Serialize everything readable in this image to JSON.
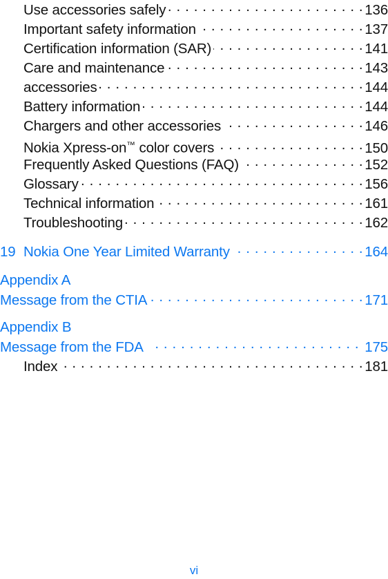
{
  "document": {
    "type": "table-of-contents",
    "folio": "vi",
    "colors": {
      "text": "#111111",
      "accent_blue": "#0d78f0",
      "background": "#ffffff"
    }
  },
  "entries": [
    {
      "number": "",
      "title": "Use accessories safely",
      "page": "136",
      "style": "black",
      "indent": true
    },
    {
      "number": "",
      "title": "Important safety information",
      "page": "137",
      "style": "black",
      "indent": true
    },
    {
      "number": "",
      "title": "Certification information (SAR)",
      "page": "141",
      "style": "black",
      "indent": true
    },
    {
      "number": "",
      "title": "Care and maintenance",
      "page": "143",
      "style": "black",
      "indent": true
    },
    {
      "number": "",
      "title": "accessories",
      "page": "144",
      "style": "black",
      "indent": true
    },
    {
      "number": "",
      "title": "Battery information",
      "page": "144",
      "style": "black",
      "indent": true
    },
    {
      "number": "",
      "title": "Chargers and other accessories",
      "page": "146",
      "style": "black",
      "indent": true
    },
    {
      "number": "",
      "title": "Nokia Xpress-on™ color covers",
      "page": "150",
      "style": "black",
      "indent": true
    },
    {
      "number": "",
      "title": "Frequently Asked Questions (FAQ)",
      "page": "152",
      "style": "black",
      "indent": true
    },
    {
      "number": "",
      "title": "Glossary",
      "page": "156",
      "style": "black",
      "indent": true
    },
    {
      "number": "",
      "title": "Technical information",
      "page": "161",
      "style": "black",
      "indent": true
    },
    {
      "number": "",
      "title": "Troubleshooting",
      "page": "162",
      "style": "black",
      "indent": true
    }
  ],
  "chapter": {
    "number": "19",
    "title": "Nokia One Year Limited Warranty",
    "page": "164",
    "style": "blue"
  },
  "appendices": [
    {
      "heading": "Appendix A",
      "title": "Message from the CTIA",
      "page": "171",
      "style": "blue"
    },
    {
      "heading": "Appendix B",
      "title": "Message from the FDA",
      "page": "175",
      "style": "blue"
    }
  ],
  "index_entry": {
    "title": "Index",
    "page": "181",
    "style": "black"
  }
}
